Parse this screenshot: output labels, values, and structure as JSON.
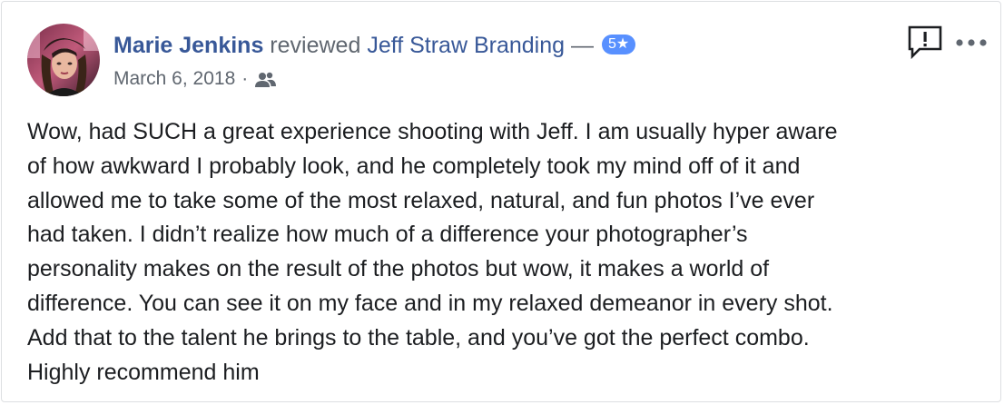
{
  "review": {
    "reviewer_name": "Marie Jenkins",
    "action_text": " reviewed ",
    "page_name": "Jeff Straw Branding",
    "dash": " — ",
    "rating_label": "5★",
    "date": "March 6, 2018",
    "separator": "·",
    "audience": "friends-icon",
    "lines": [
      "Wow, had SUCH a great experience shooting with Jeff. I am usually hyper aware",
      "of how awkward I probably look, and he completely took my mind off of it and",
      "allowed me to take some of the most relaxed, natural, and fun photos I’ve ever",
      "had taken. I didn’t realize how much of a difference your photographer’s",
      "personality makes on the result of the photos but wow, it makes a world of",
      "difference. You can see it on my face and in my relaxed demeanor in every shot.",
      "Add that to the talent he brings to the table, and you’ve got the perfect combo.",
      "Highly recommend him"
    ]
  },
  "actions": {
    "report_icon": "report-icon",
    "more_icon": "more-options-icon"
  },
  "colors": {
    "link": "#385898",
    "muted": "#606770",
    "badge": "#5890ff",
    "text": "#1c1e21"
  }
}
